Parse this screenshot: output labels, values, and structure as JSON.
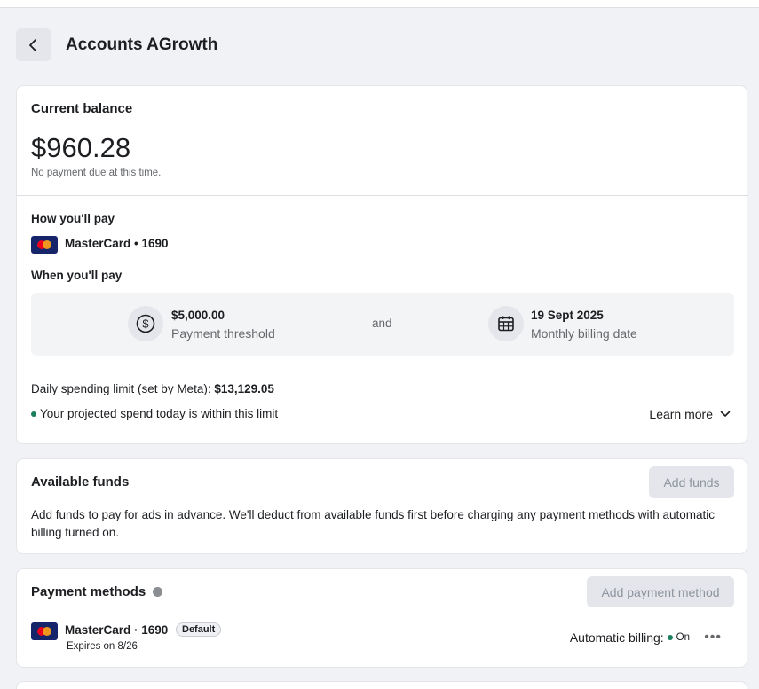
{
  "header": {
    "title": "Accounts AGrowth"
  },
  "balance_card": {
    "title": "Current balance",
    "amount": "$960.28",
    "note": "No payment due at this time.",
    "how_title": "How you'll pay",
    "card_label": "MasterCard • 1690",
    "when_title": "When you'll pay",
    "threshold_value": "$5,000.00",
    "threshold_label": "Payment threshold",
    "and_label": "and",
    "billing_date_value": "19 Sept 2025",
    "billing_date_label": "Monthly billing date",
    "limit_prefix": "Daily spending limit (set by Meta): ",
    "limit_value": "$13,129.05",
    "projection_text": "Your projected spend today is within this limit",
    "learn_more": "Learn more"
  },
  "funds_card": {
    "title": "Available funds",
    "button": "Add funds",
    "description": "Add funds to pay for ads in advance. We'll deduct from available funds first before charging any payment methods with automatic billing turned on."
  },
  "methods_card": {
    "title": "Payment methods",
    "button": "Add payment method",
    "card_label": "MasterCard · 1690",
    "badge": "Default",
    "expiry": "Expires on 8/26",
    "auto_billing_label": "Automatic billing:",
    "auto_billing_status": "On",
    "more": "•••"
  },
  "colors": {
    "background": "#f0f2f5",
    "card": "#ffffff",
    "status_green": "#1a7f5a",
    "mastercard_navy": "#16246a"
  },
  "icons": [
    "chevron-left-icon",
    "mastercard-icon",
    "dollar-circle-icon",
    "calendar-icon",
    "chevron-down-icon",
    "info-icon",
    "more-icon"
  ]
}
